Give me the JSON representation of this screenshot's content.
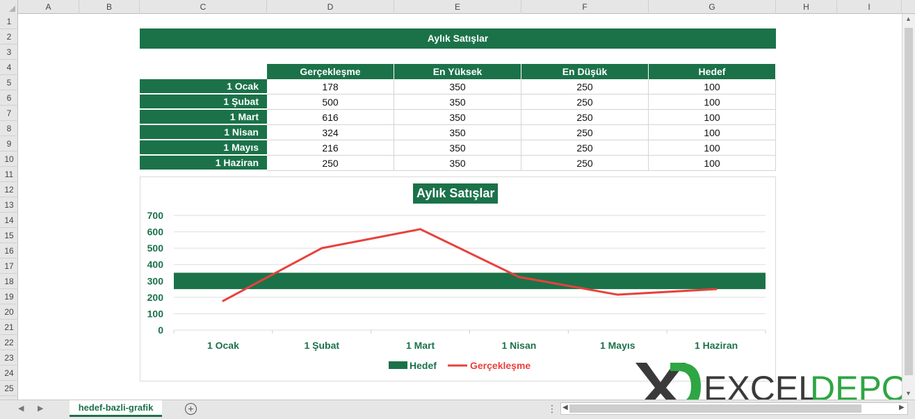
{
  "columns": [
    "A",
    "B",
    "C",
    "D",
    "E",
    "F",
    "G",
    "H",
    "I"
  ],
  "rows": [
    "1",
    "2",
    "3",
    "4",
    "5",
    "6",
    "7",
    "8",
    "9",
    "10",
    "11",
    "12",
    "13",
    "14",
    "15",
    "16",
    "17",
    "18",
    "19",
    "20",
    "21",
    "22",
    "23",
    "24",
    "25"
  ],
  "sheet_title": "Aylık Satışlar",
  "table": {
    "headers": [
      "Gerçekleşme",
      "En Yüksek",
      "En Düşük",
      "Hedef"
    ],
    "rows": [
      {
        "label": "1 Ocak",
        "values": [
          "178",
          "350",
          "250",
          "100"
        ]
      },
      {
        "label": "1 Şubat",
        "values": [
          "500",
          "350",
          "250",
          "100"
        ]
      },
      {
        "label": "1 Mart",
        "values": [
          "616",
          "350",
          "250",
          "100"
        ]
      },
      {
        "label": "1 Nisan",
        "values": [
          "324",
          "350",
          "250",
          "100"
        ]
      },
      {
        "label": "1 Mayıs",
        "values": [
          "216",
          "350",
          "250",
          "100"
        ]
      },
      {
        "label": "1 Haziran",
        "values": [
          "250",
          "350",
          "250",
          "100"
        ]
      }
    ]
  },
  "chart_data": {
    "type": "line",
    "title": "Aylık Satışlar",
    "categories": [
      "1 Ocak",
      "1 Şubat",
      "1 Mart",
      "1 Nisan",
      "1 Mayıs",
      "1 Haziran"
    ],
    "series": [
      {
        "name": "Gerçekleşme",
        "values": [
          178,
          500,
          616,
          324,
          216,
          250
        ],
        "color": "#e8413c"
      }
    ],
    "target_band": {
      "name": "Hedef",
      "low": 250,
      "high": 350,
      "color": "#1b7249"
    },
    "ylim": [
      0,
      700
    ],
    "yticks": [
      0,
      100,
      200,
      300,
      400,
      500,
      600,
      700
    ],
    "grid": true,
    "legend": "bottom"
  },
  "colors": {
    "accent": "#1b7249",
    "line": "#e8413c"
  },
  "watermark": {
    "letter": "X",
    "text_dark": "EXCEL",
    "text_green": "DEPO"
  },
  "tabbar": {
    "sheet_tab": "hedef-bazli-grafik",
    "add_label": "+",
    "menu_label": "⋮"
  },
  "icons": {
    "prev": "◀",
    "next": "▶",
    "up": "▲",
    "down": "▼"
  }
}
